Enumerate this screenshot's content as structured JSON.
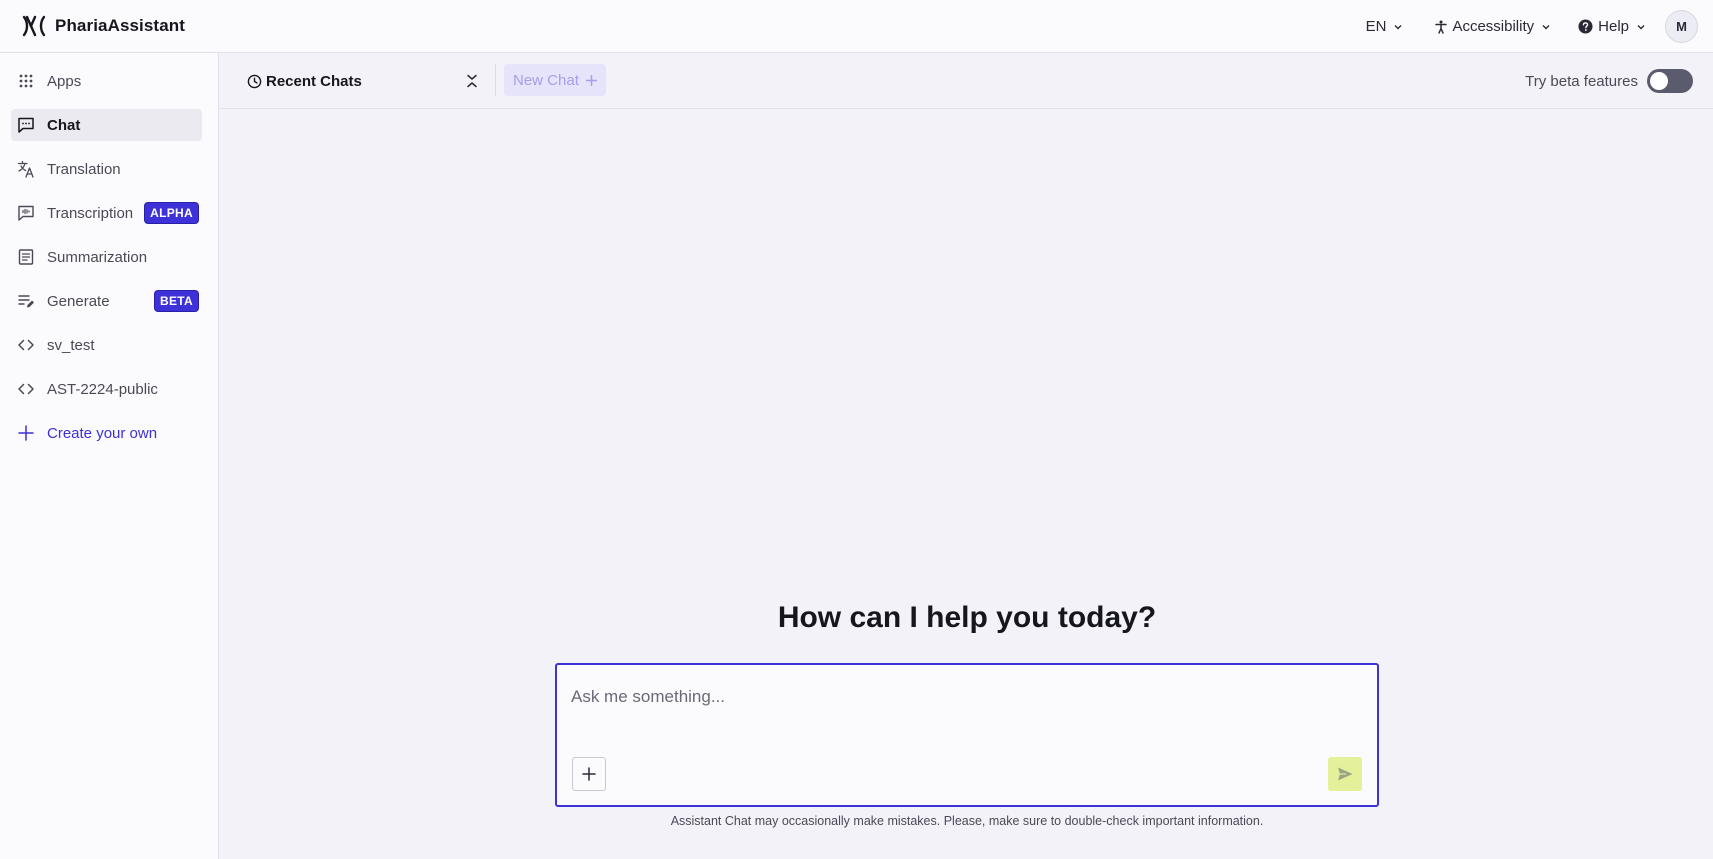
{
  "app": {
    "name": "PhariaAssistant"
  },
  "header": {
    "language": "EN",
    "accessibility_label": "Accessibility",
    "help_label": "Help",
    "avatar_initial": "M"
  },
  "sidebar": {
    "items": [
      {
        "label": "Apps",
        "icon": "grid-icon",
        "active": false
      },
      {
        "label": "Chat",
        "icon": "chat-icon",
        "active": true
      },
      {
        "label": "Translation",
        "icon": "translate-icon",
        "active": false
      },
      {
        "label": "Transcription",
        "icon": "transcription-icon",
        "active": false,
        "badge": "ALPHA"
      },
      {
        "label": "Summarization",
        "icon": "document-icon",
        "active": false
      },
      {
        "label": "Generate",
        "icon": "generate-icon",
        "active": false,
        "badge": "BETA"
      },
      {
        "label": "sv_test",
        "icon": "code-icon",
        "active": false
      },
      {
        "label": "AST-2224-public",
        "icon": "code-icon",
        "active": false
      },
      {
        "label": "Create your own",
        "icon": "plus-icon",
        "active": false
      }
    ]
  },
  "toolbar": {
    "recent_chats_label": "Recent Chats",
    "new_chat_label": "New Chat",
    "beta_label": "Try beta features",
    "beta_enabled": false
  },
  "main": {
    "headline": "How can I help you today?",
    "prompt_placeholder": "Ask me something...",
    "prompt_value": "",
    "disclaimer": "Assistant Chat may occasionally make mistakes. Please, make sure to double-check important information."
  },
  "colors": {
    "accent": "#3e31d8",
    "send_button": "#e4f09a",
    "background": "#f3f2f8",
    "sidebar": "#fbfbfd"
  }
}
